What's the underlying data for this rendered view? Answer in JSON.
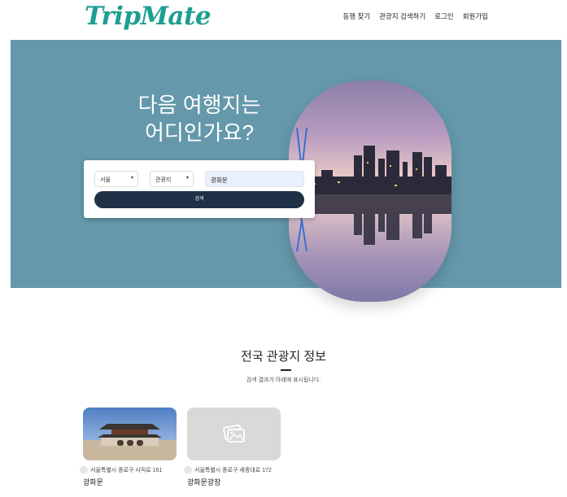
{
  "header": {
    "logo": "TripMate",
    "nav": [
      "동행 찾기",
      "관광지 검색하기",
      "로그인",
      "회원가입"
    ]
  },
  "hero": {
    "title_line1": "다음 여행지는",
    "title_line2": "어디인가요?",
    "search": {
      "region": "서울",
      "category": "관광지",
      "keyword": "광화문",
      "button": "검색"
    }
  },
  "section": {
    "title": "전국 관광지 정보",
    "subtitle": "검색 결과가 아래에 표시됩니다."
  },
  "results": [
    {
      "address": "서울특별시 종로구 사직로 161",
      "name": "광화문"
    },
    {
      "address": "서울특별시 종로구 세종대로 172",
      "name": "광화문광장"
    }
  ],
  "colors": {
    "brand": "#1d9e92",
    "hero_bg": "#6498aa",
    "button_bg": "#1f3147"
  }
}
